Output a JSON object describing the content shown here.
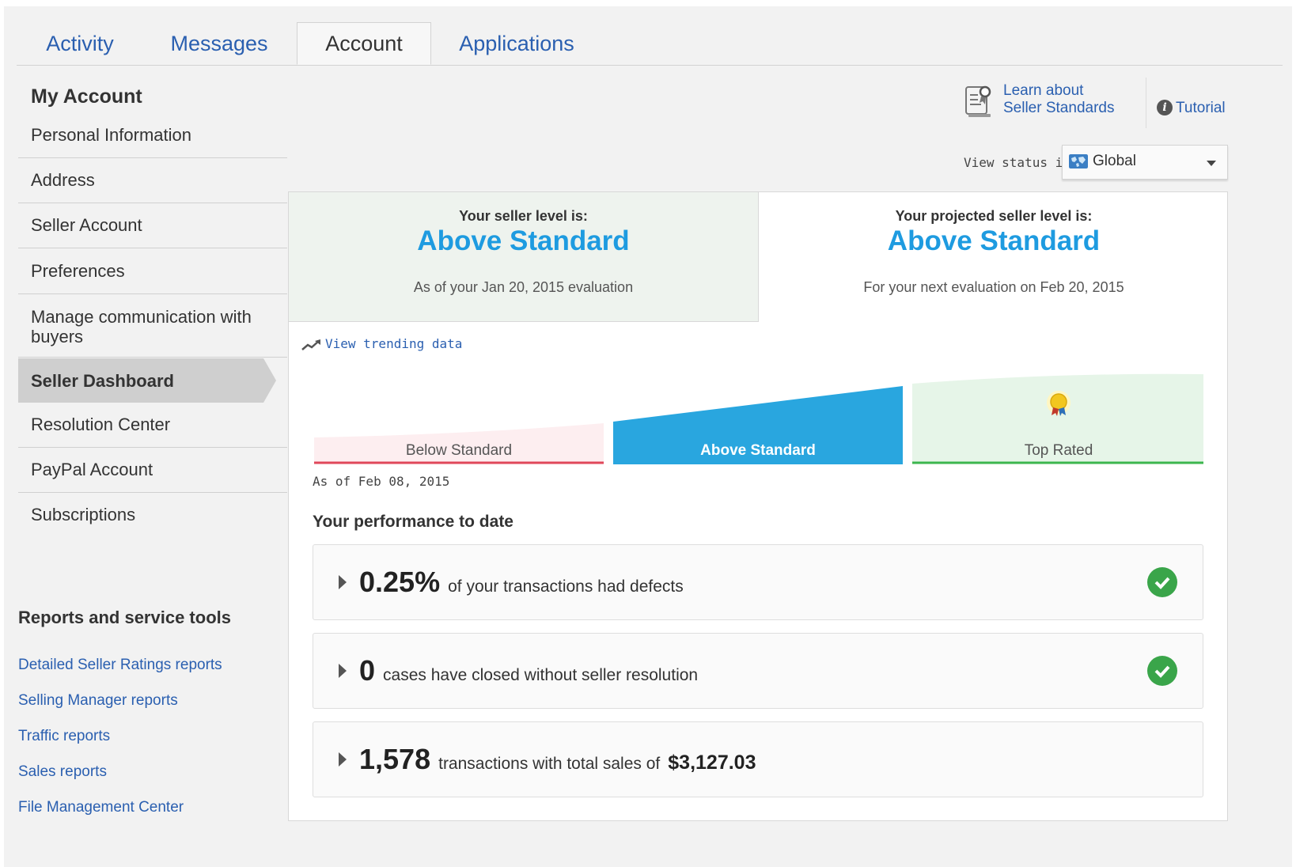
{
  "tabs": [
    {
      "label": "Activity"
    },
    {
      "label": "Messages"
    },
    {
      "label": "Account"
    },
    {
      "label": "Applications"
    }
  ],
  "sidebar": {
    "title": "My Account",
    "items": [
      {
        "label": "Personal Information"
      },
      {
        "label": "Address"
      },
      {
        "label": "Seller Account"
      },
      {
        "label": "Preferences"
      },
      {
        "label": "Manage communication with buyers"
      },
      {
        "label": "Seller Dashboard"
      },
      {
        "label": "Resolution Center"
      },
      {
        "label": "PayPal Account"
      },
      {
        "label": "Subscriptions"
      }
    ],
    "reports_title": "Reports and service tools",
    "reports": [
      {
        "label": "Detailed Seller Ratings reports"
      },
      {
        "label": "Selling Manager reports"
      },
      {
        "label": "Traffic reports"
      },
      {
        "label": "Sales reports"
      },
      {
        "label": "File Management Center"
      }
    ]
  },
  "header": {
    "learn_line1": "Learn about",
    "learn_line2": "Seller Standards",
    "tutorial": "Tutorial",
    "view_status_label": "View status in:",
    "view_status_value": "Global"
  },
  "levels": {
    "current_label": "Your seller level is:",
    "current_value": "Above Standard",
    "current_note": "As of your Jan 20, 2015 evaluation",
    "projected_label": "Your projected seller level is:",
    "projected_value": "Above Standard",
    "projected_note": "For your next evaluation on Feb 20, 2015"
  },
  "trend_link": "View trending data",
  "meter": {
    "below": "Below Standard",
    "above": "Above Standard",
    "top": "Top Rated",
    "as_of": "As of Feb 08, 2015",
    "colors": {
      "below": "#e0475a",
      "above": "#29a6df",
      "top": "#3cb64e"
    }
  },
  "performance": {
    "title": "Your performance to date",
    "metrics": [
      {
        "value": "0.25%",
        "text": "of your transactions had defects"
      },
      {
        "value": "0",
        "text": "cases have closed without seller resolution"
      },
      {
        "value": "1,578",
        "text": "transactions with total sales of",
        "amount": "$3,127.03"
      }
    ]
  }
}
